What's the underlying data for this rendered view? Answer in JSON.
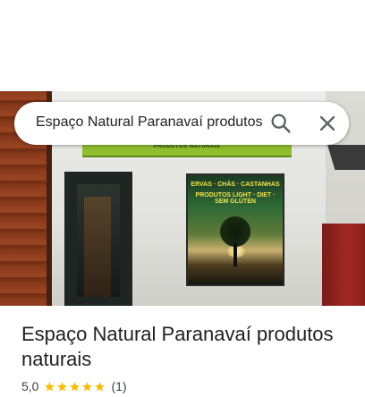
{
  "search": {
    "query": "Espaço Natural Paranavaí produtos"
  },
  "photo": {
    "banner_text": "PRODUTOS NATURAIS",
    "window_line1": "ERVAS · CHÁS · CASTANHAS",
    "window_line2": "PRODUTOS LIGHT · DIET · SEM GLÚTEN"
  },
  "place": {
    "title": "Espaço Natural Paranavaí produtos naturais",
    "rating": "5,0",
    "stars": 5,
    "review_count": "(1)"
  },
  "colors": {
    "star": "#fbbc04",
    "text": "#202124",
    "icon": "#5f6368"
  }
}
